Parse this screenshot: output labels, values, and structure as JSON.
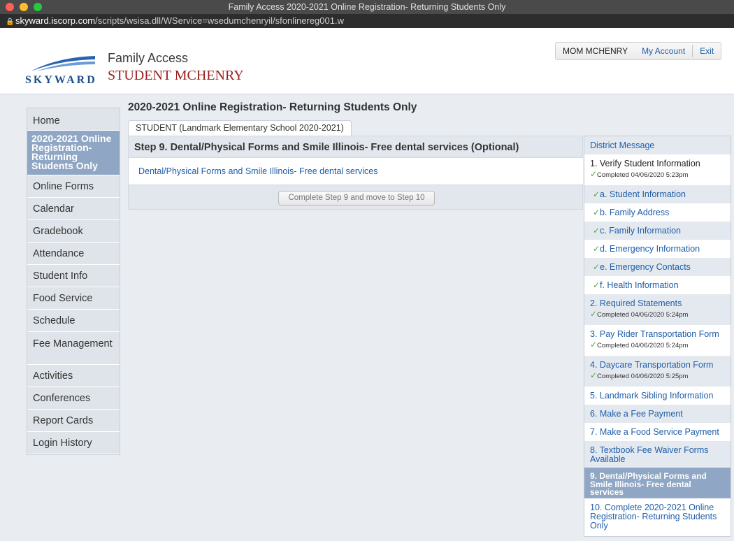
{
  "window": {
    "title": "Family Access 2020-2021 Online Registration- Returning Students Only",
    "url_domain": "skyward.iscorp.com",
    "url_path": "/scripts/wsisa.dll/WService=wsedumchenryil/sfonlinereg001.w"
  },
  "header": {
    "logo_text": "SKYWARD",
    "family_access": "Family Access",
    "student_name": "STUDENT MCHENRY",
    "user_name": "MOM MCHENRY",
    "my_account": "My Account",
    "exit": "Exit"
  },
  "nav": {
    "items": [
      "Home",
      "2020-2021 Online Registration- Returning Students Only",
      "Online Forms",
      "Calendar",
      "Gradebook",
      "Attendance",
      "Student Info",
      "Food Service",
      "Schedule",
      "Fee Management",
      "Activities",
      "Conferences",
      "Report Cards",
      "Login History"
    ]
  },
  "main": {
    "heading": "2020-2021 Online Registration- Returning Students Only",
    "tab": "STUDENT (Landmark Elementary School 2020-2021)",
    "step_title": "Step 9. Dental/Physical Forms and Smile Illinois- Free dental services (Optional)",
    "step_link": "Dental/Physical Forms and Smile Illinois- Free dental services",
    "complete_button": "Complete Step 9 and move to Step 10"
  },
  "steps": {
    "district_message": "District Message",
    "s1": "1. Verify Student Information",
    "s1_completed": "Completed 04/06/2020 5:23pm",
    "s1a": "a. Student Information",
    "s1b": "b. Family Address",
    "s1c": "c. Family Information",
    "s1d": "d. Emergency Information",
    "s1e": "e. Emergency Contacts",
    "s1f": "f. Health Information",
    "s2": "2. Required Statements",
    "s2_completed": "Completed 04/06/2020 5:24pm",
    "s3": "3. Pay Rider Transportation Form",
    "s3_completed": "Completed 04/06/2020 5:24pm",
    "s4": "4. Daycare Transportation Form",
    "s4_completed": "Completed 04/06/2020 5:25pm",
    "s5": "5. Landmark Sibling Information",
    "s6": "6. Make a Fee Payment",
    "s7": "7. Make a Food Service Payment",
    "s8": "8. Textbook Fee Waiver Forms Available",
    "s9": "9. Dental/Physical Forms and Smile Illinois- Free dental services",
    "s10": "10. Complete 2020-2021 Online Registration- Returning Students Only"
  }
}
